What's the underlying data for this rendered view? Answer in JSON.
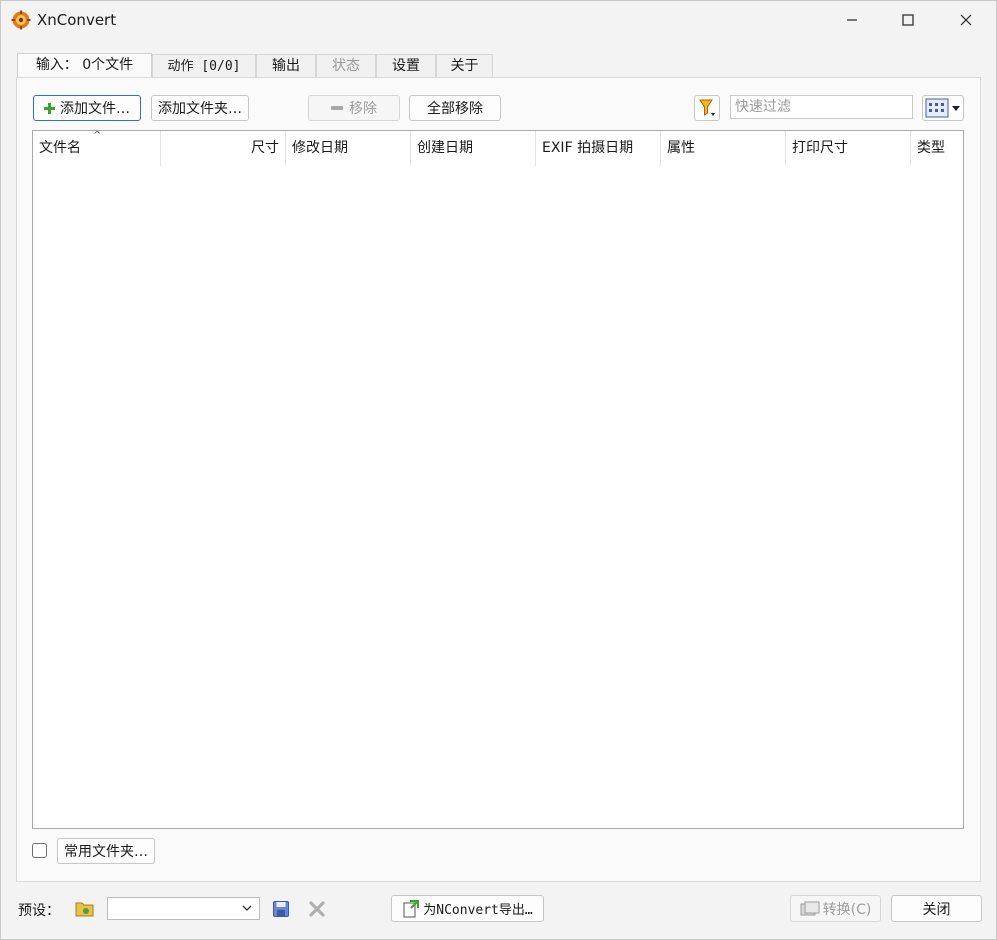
{
  "window": {
    "title": "XnConvert",
    "controls": {
      "minimize": "—",
      "maximize": "☐",
      "close": "✕"
    }
  },
  "tabs": [
    {
      "label": "输入： 0个文件",
      "active": true,
      "disabled": false
    },
    {
      "label": "动作 [0/0]",
      "active": false,
      "disabled": false
    },
    {
      "label": "输出",
      "active": false,
      "disabled": false
    },
    {
      "label": "状态",
      "active": false,
      "disabled": true
    },
    {
      "label": "设置",
      "active": false,
      "disabled": false
    },
    {
      "label": "关于",
      "active": false,
      "disabled": false
    }
  ],
  "toolbar": {
    "add_files": "添加文件…",
    "add_folder": "添加文件夹…",
    "remove": "移除",
    "remove_all": "全部移除",
    "quick_filter_placeholder": "快速过滤"
  },
  "file_list": {
    "columns": [
      "文件名",
      "尺寸",
      "修改日期",
      "创建日期",
      "EXIF 拍摄日期",
      "属性",
      "打印尺寸",
      "类型"
    ],
    "sort_indicator": "^",
    "rows": []
  },
  "favorites": {
    "button": "常用文件夹…",
    "checked": false
  },
  "footer": {
    "presets_label": "预设：",
    "preset_value": "",
    "export_nconvert": "为NConvert导出…",
    "convert": "转换(C)",
    "close": "关闭"
  },
  "colors": {
    "accent": "#2f72c7",
    "add_green": "#3aa42f",
    "icon_orange": "#e07a1f"
  }
}
